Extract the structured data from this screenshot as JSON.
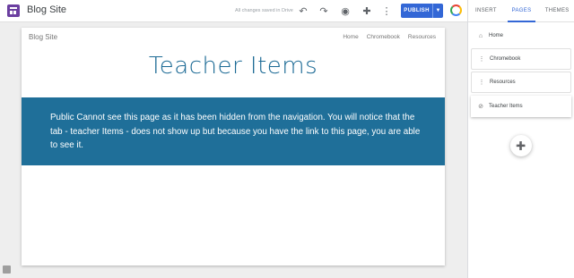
{
  "app": {
    "site_name": "Blog Site",
    "saved_status": "All changes saved in Drive",
    "publish_label": "PUBLISH"
  },
  "toolbar_icons": [
    "undo-icon",
    "redo-icon",
    "preview-icon",
    "share-icon",
    "more-icon"
  ],
  "site": {
    "nav_title": "Blog Site",
    "nav_links": [
      "Home",
      "Chromebook",
      "Resources"
    ],
    "page_title": "Teacher Items",
    "banner_text": "Public Cannot see this page as it has been hidden from the navigation. You will notice that the tab - teacher Items - does not show up but because you have the link to this page, you are able to see it."
  },
  "panel": {
    "tabs": [
      "INSERT",
      "PAGES",
      "THEMES"
    ],
    "active_tab": "PAGES",
    "pages": [
      {
        "label": "Home",
        "icon": "home-icon"
      },
      {
        "label": "Chromebook",
        "icon": "drag-handle-icon"
      },
      {
        "label": "Resources",
        "icon": "drag-handle-icon"
      },
      {
        "label": "Teacher Items",
        "icon": "hidden-link-icon"
      }
    ]
  },
  "colors": {
    "accent": "#3367d6",
    "banner": "#1f6f99",
    "heading": "#1c6a95"
  }
}
